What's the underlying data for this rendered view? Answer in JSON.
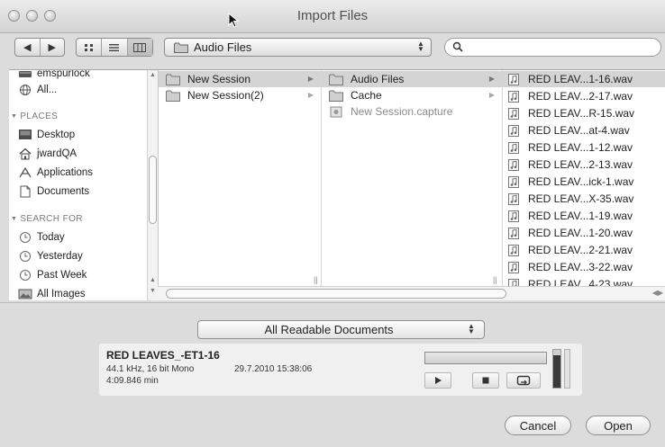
{
  "window": {
    "title": "Import Files"
  },
  "toolbar": {
    "back_icon": "back-arrow-icon",
    "forward_icon": "forward-arrow-icon",
    "view_icons": [
      "icon-view-icon",
      "list-view-icon",
      "column-view-icon"
    ],
    "location": "Audio Files",
    "search_value": ""
  },
  "sidebar": {
    "devices": [
      {
        "label": "emspurlock",
        "icon": "drive-icon"
      },
      {
        "label": "All...",
        "icon": "network-icon"
      }
    ],
    "places_header": "PLACES",
    "places": [
      {
        "label": "Desktop",
        "icon": "desktop-icon"
      },
      {
        "label": "jwardQA",
        "icon": "home-icon"
      },
      {
        "label": "Applications",
        "icon": "applications-icon"
      },
      {
        "label": "Documents",
        "icon": "documents-icon"
      }
    ],
    "search_header": "SEARCH FOR",
    "searches": [
      {
        "label": "Today",
        "icon": "clock-icon"
      },
      {
        "label": "Yesterday",
        "icon": "clock-icon"
      },
      {
        "label": "Past Week",
        "icon": "clock-icon"
      },
      {
        "label": "All Images",
        "icon": "images-icon"
      }
    ]
  },
  "columns": {
    "col1": [
      {
        "label": "New Session",
        "selected": true,
        "has_children": true
      },
      {
        "label": "New Session(2)",
        "selected": false,
        "has_children": true
      }
    ],
    "col2": [
      {
        "label": "Audio Files",
        "selected": true,
        "has_children": true,
        "type": "folder"
      },
      {
        "label": "Cache",
        "selected": false,
        "has_children": true,
        "type": "folder"
      },
      {
        "label": "New Session.capture",
        "selected": false,
        "has_children": false,
        "type": "document"
      }
    ],
    "col3": [
      "RED LEAV...1-16.wav",
      "RED LEAV...2-17.wav",
      "RED LEAV...R-15.wav",
      "RED LEAV...at-4.wav",
      "RED LEAV...1-12.wav",
      "RED LEAV...2-13.wav",
      "RED LEAV...ick-1.wav",
      "RED LEAV...X-35.wav",
      "RED LEAV...1-19.wav",
      "RED LEAV...1-20.wav",
      "RED LEAV...2-21.wav",
      "RED LEAV...3-22.wav",
      "RED LEAV...4-23.wav"
    ]
  },
  "format": {
    "selected": "All Readable Documents"
  },
  "preview": {
    "name": "RED LEAVES_-ET1-16",
    "format": "44.1 kHz, 16 bit Mono",
    "duration": "4:09.846 min",
    "date": "29.7.2010 15:38:06",
    "progress": 0.0,
    "level": 0.85
  },
  "buttons": {
    "cancel": "Cancel",
    "open": "Open"
  }
}
